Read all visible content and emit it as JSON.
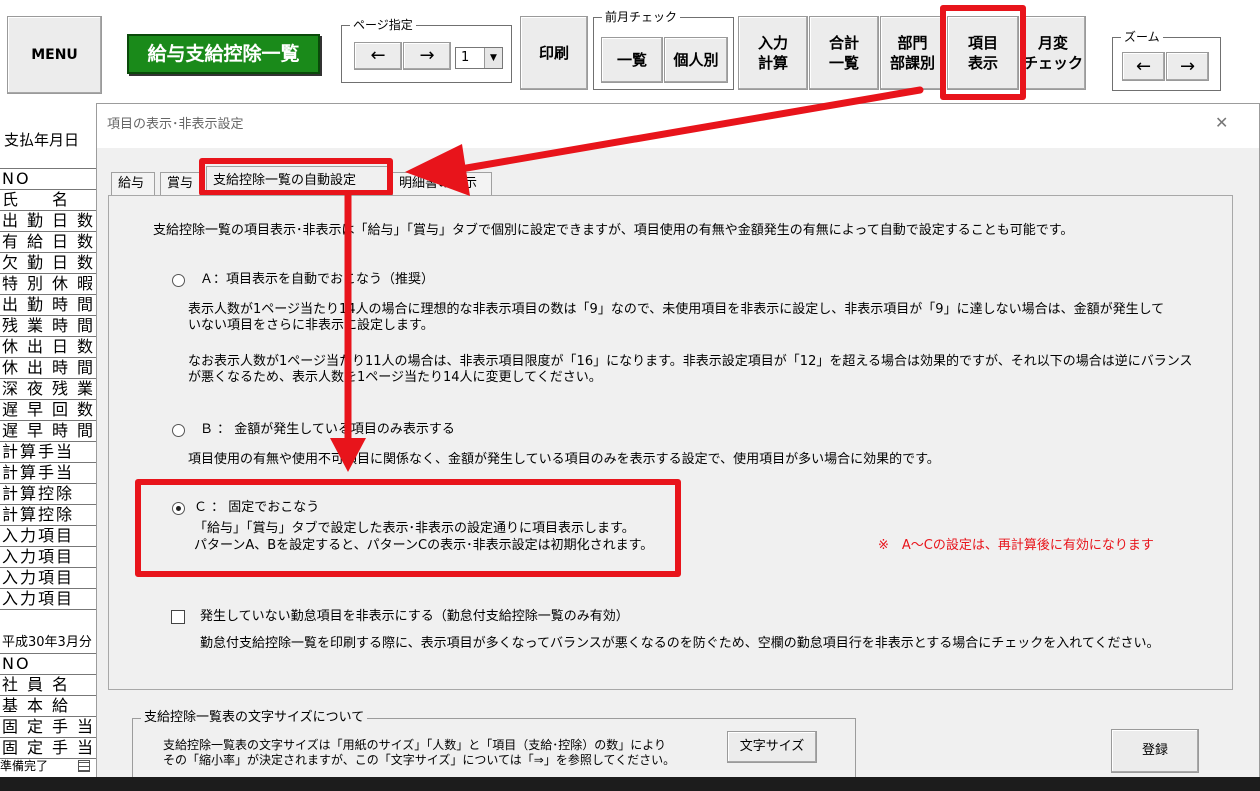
{
  "toolbar": {
    "menu": "MENU",
    "title": "給与支給控除一覧",
    "page_group_label": "ページ指定",
    "prev_arrow": "←",
    "next_arrow": "→",
    "page_value": "1",
    "print": "印刷",
    "prev_month_label": "前月チェック",
    "ichiran": "一覧",
    "kojinbetsu": "個人別",
    "input_calc": "入力\n計算",
    "total_list": "合計\n一覧",
    "dept": "部門\n部課別",
    "item_display": "項目\n表示",
    "monthly_check": "月変\nチェック",
    "zoom_label": "ズーム",
    "zoom_out": "←",
    "zoom_in": "→"
  },
  "sheet": {
    "pay_date_label": "支払年月日",
    "rows1": [
      "NO",
      "氏　名",
      "出勤日数",
      "有給日数",
      "欠勤日数",
      "特別休暇",
      "出勤時間",
      "残業時間",
      "休出日数",
      "休出時間",
      "深夜残業",
      "遅早回数",
      "遅早時間",
      "計算手当",
      "計算手当",
      "計算控除",
      "計算控除",
      "入力項目",
      "入力項目",
      "入力項目",
      "入力項目"
    ],
    "period": "平成30年3月分",
    "rows2": [
      "NO",
      "社員名",
      "基本給",
      "固定手当",
      "固定手当"
    ],
    "status": "準備完了"
  },
  "dialog": {
    "title": "項目の表示･非表示設定",
    "close": "✕",
    "tabs": [
      "給与",
      "賞与",
      "支給控除一覧の自動設定",
      "明細書の表示"
    ],
    "intro": "支給控除一覧の項目表示･非表示は「給与」「賞与」タブで個別に設定できますが、項目使用の有無や金額発生の有無によって自動で設定することも可能です。",
    "option_a": {
      "label": "Ａ：項目表示を自動でおこなう（推奨）",
      "desc1": "表示人数が1ページ当たり14人の場合に理想的な非表示項目の数は「9」なので、未使用項目を非表示に設定し、非表示項目が「9」に達しない場合は、金額が発生して",
      "desc2": "いない項目をさらに非表示に設定します。",
      "desc3": "なお表示人数が1ページ当たり11人の場合は、非表示項目限度が「16」になります。非表示設定項目が「12」を超える場合は効果的ですが、それ以下の場合は逆にバランス",
      "desc4": "が悪くなるため、表示人数を1ページ当たり14人に変更してください。"
    },
    "option_b": {
      "label": "Ｂ ： 金額が発生している項目のみ表示する",
      "desc": "項目使用の有無や使用不可項目に関係なく、金額が発生している項目のみを表示する設定で、使用項目が多い場合に効果的です。"
    },
    "option_c": {
      "label": "Ｃ ： 固定でおこなう",
      "desc1": "「給与」「賞与」タブで設定した表示･非表示の設定通りに項目表示します。",
      "desc2": "パターンA、Bを設定すると、パターンCの表示･非表示設定は初期化されます。"
    },
    "note": "※　A～Cの設定は、再計算後に有効になります",
    "checkbox_label": "発生していない勤怠項目を非表示にする（勤怠付支給控除一覧のみ有効）",
    "checkbox_desc": "勤怠付支給控除一覧を印刷する際に、表示項目が多くなってバランスが悪くなるのを防ぐため、空欄の勤怠項目行を非表示とする場合にチェックを入れてください。",
    "font_group_label": "支給控除一覧表の文字サイズについて",
    "font_desc1": "支給控除一覧表の文字サイズは「用紙のサイズ」「人数」と「項目（支給･控除）の数」により",
    "font_desc2": "その「縮小率」が決定されますが、この「文字サイズ」については「⇒」を参照してください。",
    "font_size_button": "文字サイズ",
    "register_button": "登録"
  },
  "colors": {
    "title_green": "#1a8a1a",
    "highlight_red": "#e8141b",
    "note_red": "#e8141b"
  }
}
